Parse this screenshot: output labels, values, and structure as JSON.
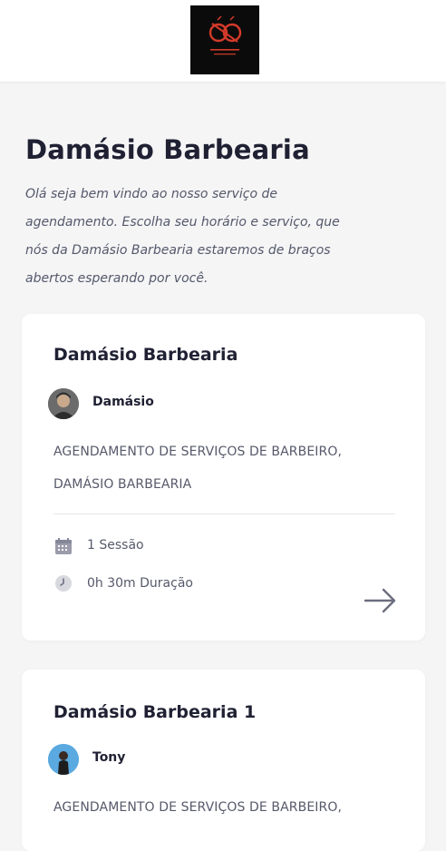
{
  "header": {
    "logo_icon": "damasio-barbearia-logo",
    "logo_colors": {
      "background": "#0b0b0b",
      "mark": "#d43a2a"
    }
  },
  "intro": {
    "title": "Damásio Barbearia",
    "text": "Olá seja bem vindo ao nosso serviço de agendamento. Escolha seu horário e serviço, que nós da Damásio Barbearia estaremos de braços abertos esperando por você."
  },
  "services": [
    {
      "title": "Damásio Barbearia",
      "staff": "Damásio",
      "description": "AGENDAMENTO DE SERVIÇOS DE BARBEIRO, DAMÁSIO BARBEARIA",
      "sessions": "1 Sessão",
      "duration": "0h 30m Duração",
      "arrow_icon": "arrow-right-icon"
    },
    {
      "title": "Damásio Barbearia 1",
      "staff": "Tony",
      "description": "AGENDAMENTO DE SERVIÇOS DE BARBEIRO,"
    }
  ]
}
